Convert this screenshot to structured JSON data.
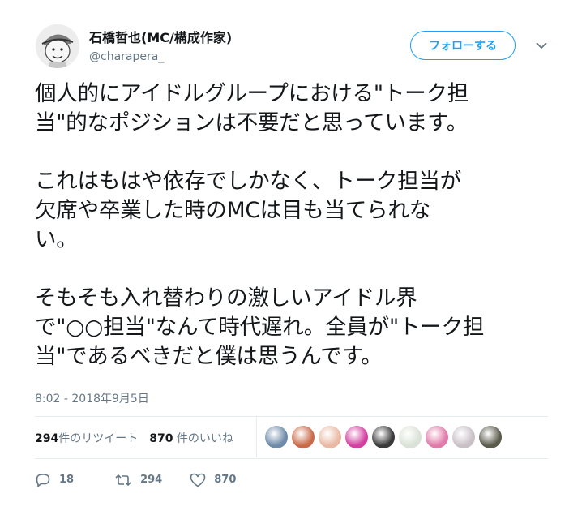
{
  "user": {
    "display_name": "石橋哲也(MC/構成作家)",
    "handle": "@charapera_"
  },
  "follow_button": {
    "label": "フォローする"
  },
  "tweet": {
    "paragraphs": [
      [
        "個人的にアイドルグループにおける\"トーク担",
        "当\"的なポジションは不要だと思っています。"
      ],
      [
        "これはもはや依存でしかなく、トーク担当が",
        "欠席や卒業した時のMCは目も当てられな",
        "い。"
      ],
      [
        "そもそも入れ替わりの激しいアイドル界",
        "で\"○○担当\"なんて時代遅れ。全員が\"トーク担",
        "当\"であるべきだと僕は思うんです。"
      ]
    ],
    "timestamp": "8:02 - 2018年9月5日"
  },
  "stats": {
    "retweet_count": "294",
    "retweet_label": "件のリツイート",
    "like_count": "870",
    "like_label": "件のいいね"
  },
  "actions": {
    "reply_count": "18",
    "retweet_count": "294",
    "like_count": "870"
  },
  "likers": [
    {
      "name": "liker-avatar-1",
      "color": "#6d8aa8"
    },
    {
      "name": "liker-avatar-2",
      "color": "#c96b4a"
    },
    {
      "name": "liker-avatar-3",
      "color": "#e9b9a4"
    },
    {
      "name": "liker-avatar-4",
      "color": "#d23fa0"
    },
    {
      "name": "liker-avatar-5",
      "color": "#3a3a3a"
    },
    {
      "name": "liker-avatar-6",
      "color": "#d9e2d6"
    },
    {
      "name": "liker-avatar-7",
      "color": "#e07aa8"
    },
    {
      "name": "liker-avatar-8",
      "color": "#c9c0c6"
    },
    {
      "name": "liker-avatar-9",
      "color": "#5b5b4c"
    }
  ],
  "colors": {
    "accent": "#1da1f2",
    "text": "#14171a",
    "muted": "#657786"
  }
}
